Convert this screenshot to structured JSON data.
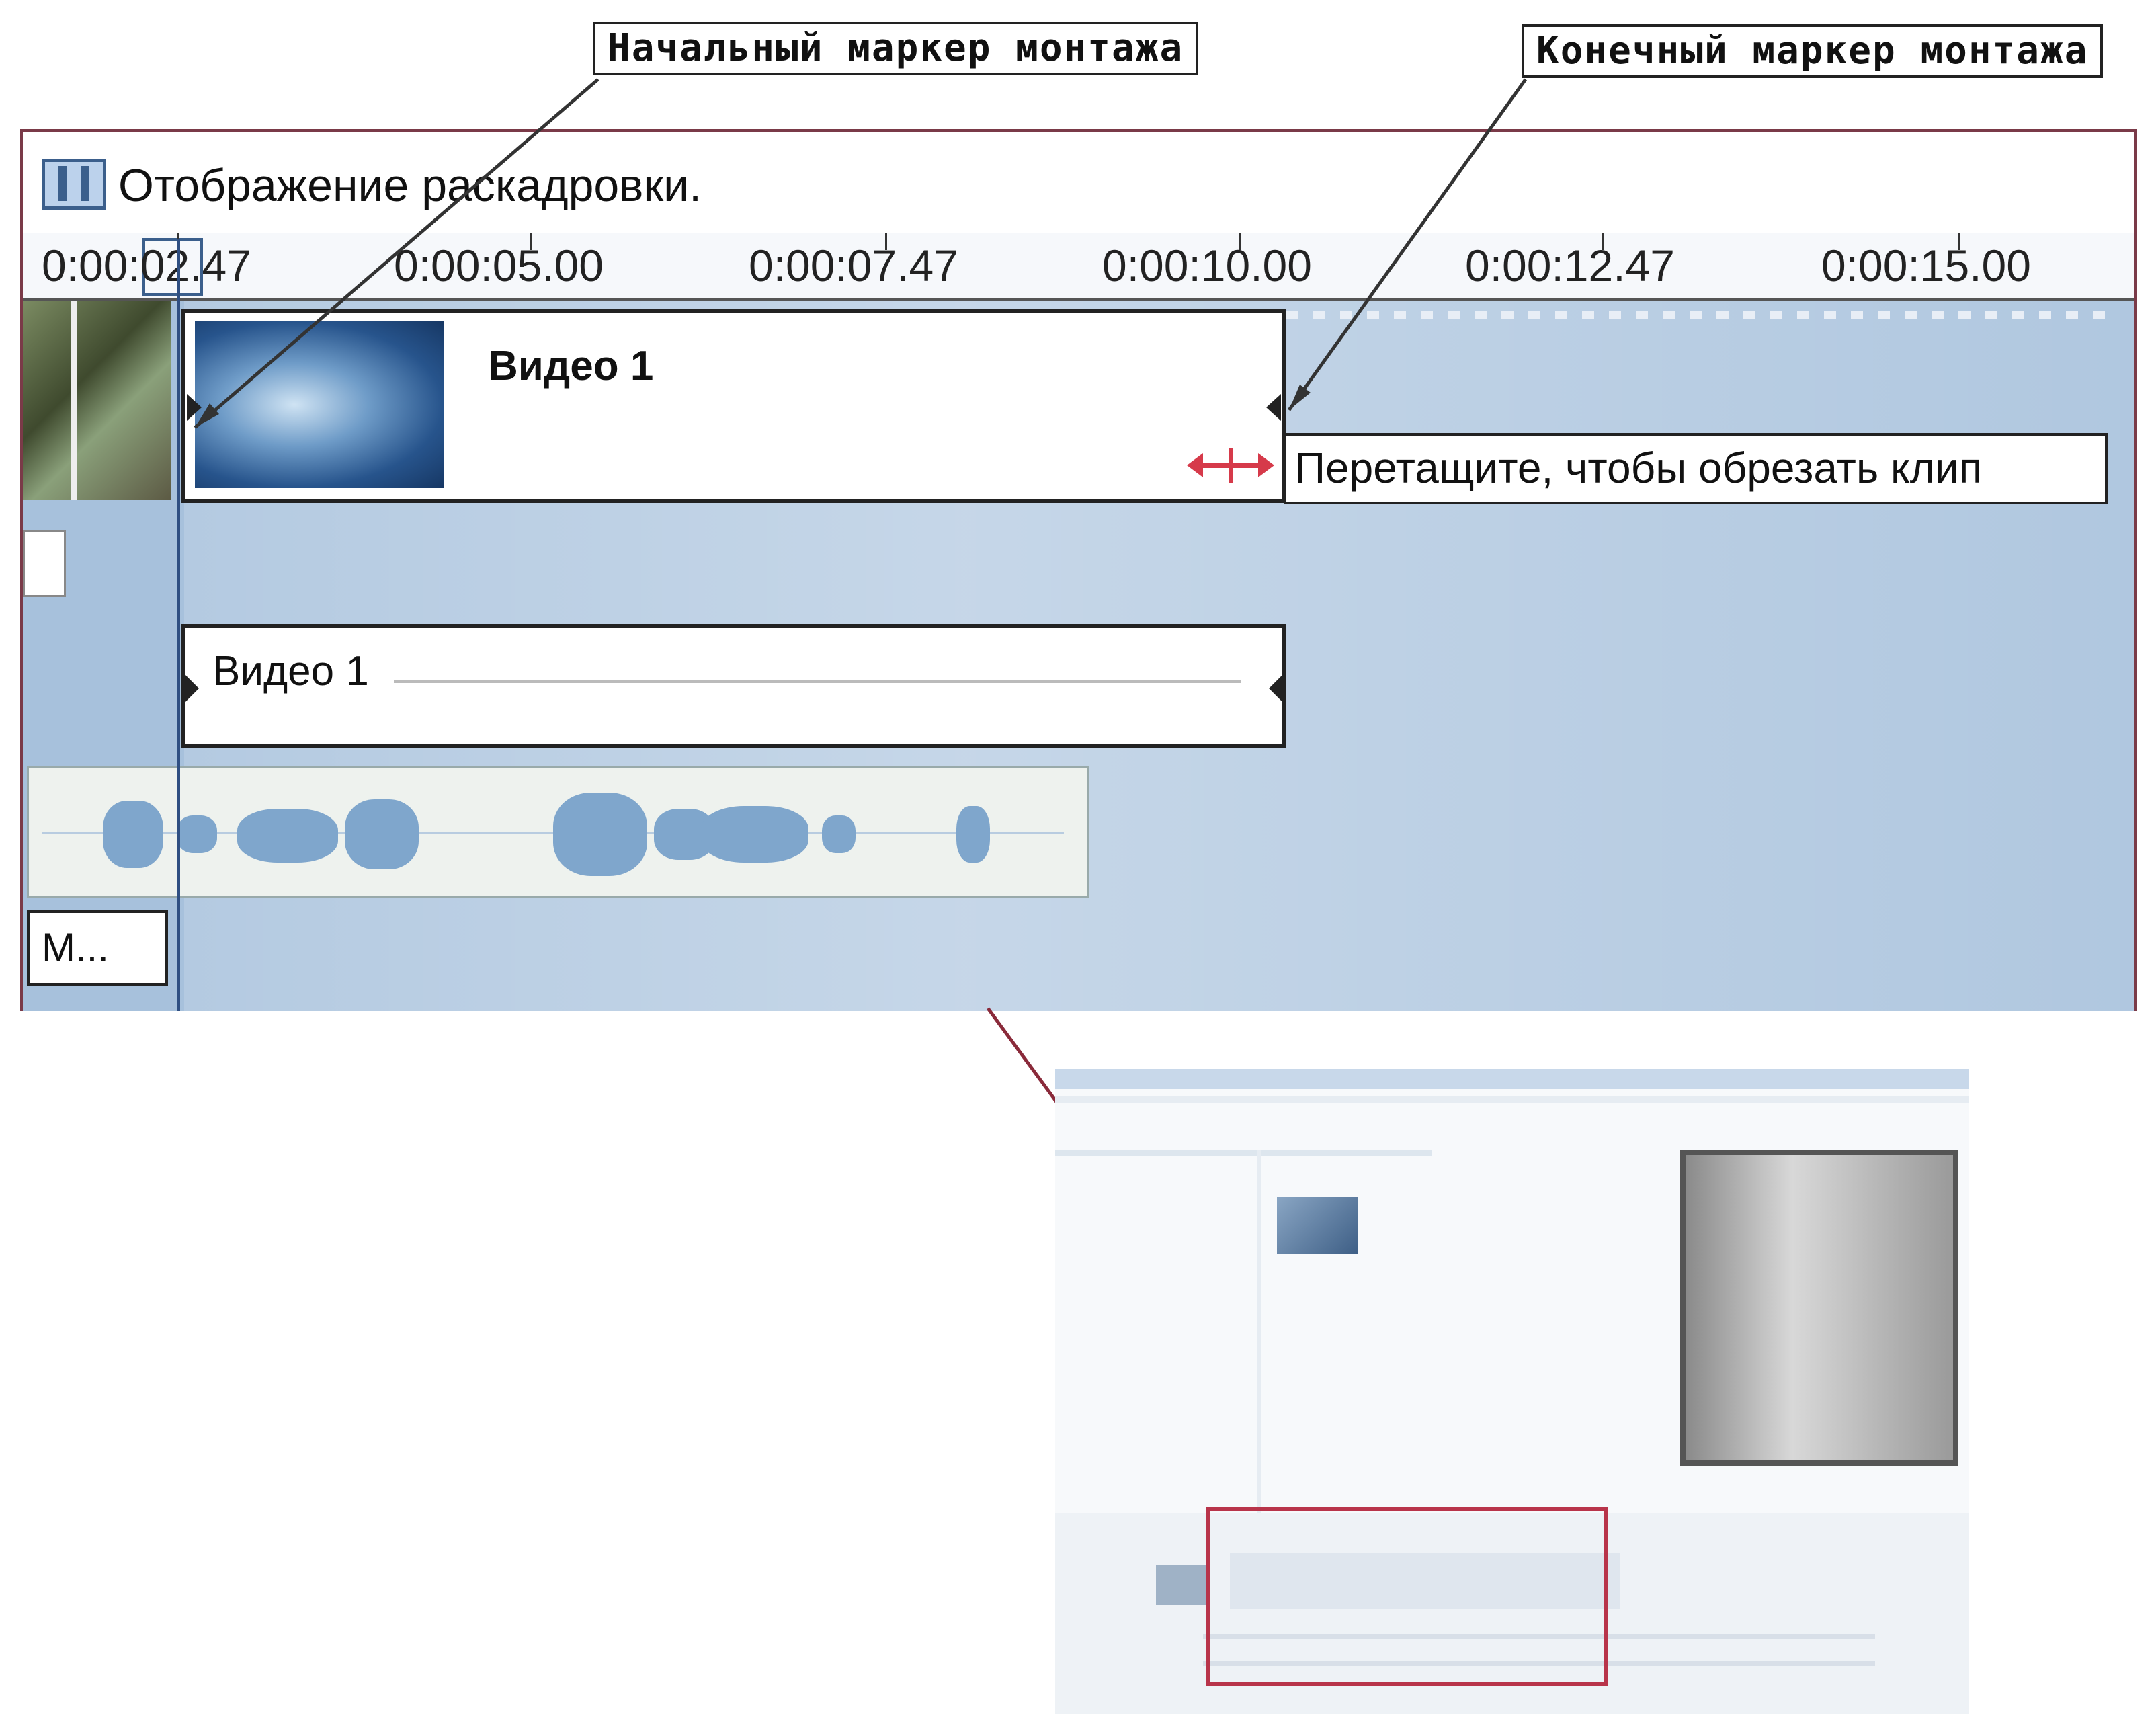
{
  "callouts": {
    "start_marker": "Начальный маркер монтажа",
    "end_marker": "Конечный маркер монтажа"
  },
  "view": {
    "label": "Отображение раскадровки."
  },
  "ruler": {
    "ticks": [
      "0:00:02.47",
      "0:00:05.00",
      "0:00:07.47",
      "0:00:10.00",
      "0:00:12.47",
      "0:00:15.00"
    ]
  },
  "video_track": {
    "clip_title": "Видео 1",
    "tooltip": "Перетащите, чтобы обрезать клип"
  },
  "audio_track": {
    "clip_title": "Видео 1"
  },
  "music_track": {
    "label": "М..."
  },
  "colors": {
    "track": "#a7c1dc",
    "frame": "#7a3a48",
    "trim_handle": "#d63a4a",
    "accent": "#3b5f8c"
  },
  "icons": [
    "storyboard-icon",
    "trim-handle-icon",
    "start-marker-icon",
    "end-marker-icon"
  ]
}
